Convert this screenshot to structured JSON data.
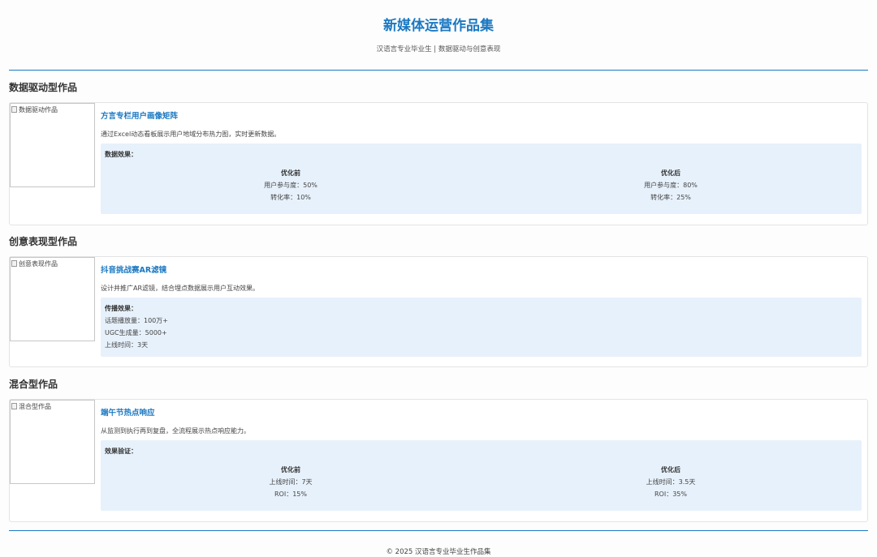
{
  "header": {
    "title": "新媒体运营作品集",
    "subtitle": "汉语言专业毕业生 | 数据驱动与创意表现"
  },
  "sections": [
    {
      "title": "数据驱动型作品",
      "image_alt": "数据驱动作品",
      "project_title": "方言专栏用户画像矩阵",
      "description": "通过Excel动态看板展示用户地域分布热力图，实时更新数据。",
      "effect_label": "数据效果：",
      "before": {
        "heading": "优化前",
        "lines": [
          "用户参与度：50%",
          "转化率：10%"
        ]
      },
      "after": {
        "heading": "优化后",
        "lines": [
          "用户参与度：80%",
          "转化率：25%"
        ]
      }
    },
    {
      "title": "创意表现型作品",
      "image_alt": "创意表现作品",
      "project_title": "抖音挑战赛AR滤镜",
      "description": "设计并推广AR滤镜，结合埋点数据展示用户互动效果。",
      "effect_label": "传播效果：",
      "lines": [
        "话题播放量：100万+",
        "UGC生成量：5000+",
        "上线时间：3天"
      ]
    },
    {
      "title": "混合型作品",
      "image_alt": "混合型作品",
      "project_title": "端午节热点响应",
      "description": "从监测到执行再到复盘，全流程展示热点响应能力。",
      "effect_label": "效果验证：",
      "before": {
        "heading": "优化前",
        "lines": [
          "上线时间：7天",
          "ROI：15%"
        ]
      },
      "after": {
        "heading": "优化后",
        "lines": [
          "上线时间：3.5天",
          "ROI：35%"
        ]
      }
    }
  ],
  "footer": {
    "text": "© 2025 汉语言专业毕业生作品集"
  },
  "colors": {
    "accent": "#1a78c2",
    "effect_bg": "#e7f1fb"
  }
}
